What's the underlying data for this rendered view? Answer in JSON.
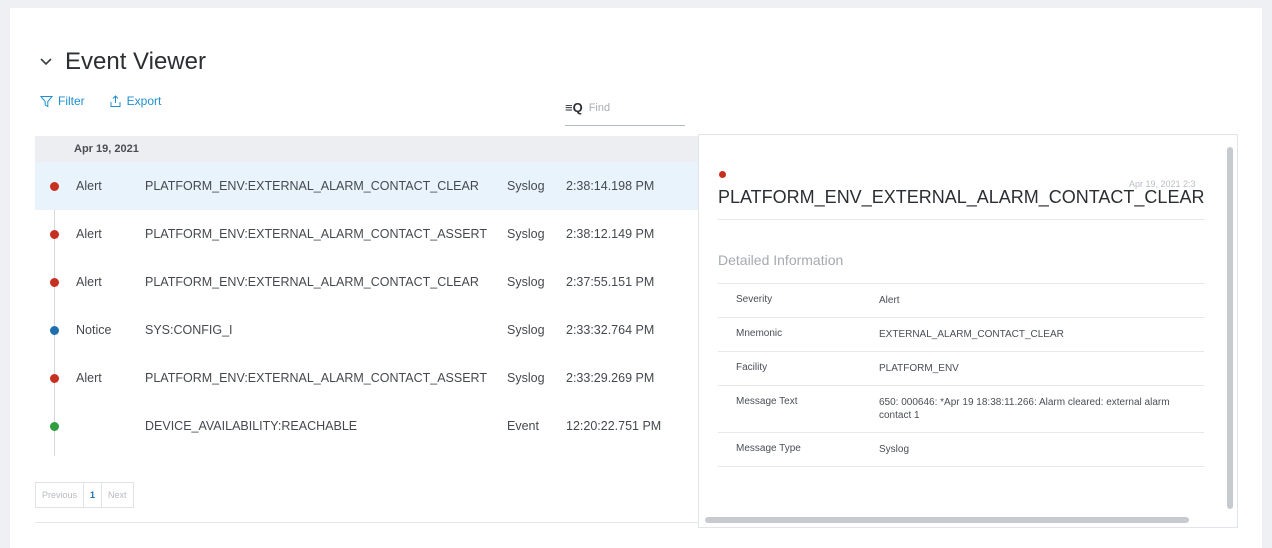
{
  "header": {
    "title": "Event Viewer"
  },
  "toolbar": {
    "filter_label": "Filter",
    "export_label": "Export"
  },
  "search": {
    "icon_label": "≡Q",
    "placeholder": "Find"
  },
  "list": {
    "date": "Apr 19, 2021",
    "events": [
      {
        "severity": "Alert",
        "mnemonic": "PLATFORM_ENV:EXTERNAL_ALARM_CONTACT_CLEAR",
        "source": "Syslog",
        "time": "2:38:14.198 PM",
        "color": "#c7301e"
      },
      {
        "severity": "Alert",
        "mnemonic": "PLATFORM_ENV:EXTERNAL_ALARM_CONTACT_ASSERT",
        "source": "Syslog",
        "time": "2:38:12.149 PM",
        "color": "#c7301e"
      },
      {
        "severity": "Alert",
        "mnemonic": "PLATFORM_ENV:EXTERNAL_ALARM_CONTACT_CLEAR",
        "source": "Syslog",
        "time": "2:37:55.151 PM",
        "color": "#c7301e"
      },
      {
        "severity": "Notice",
        "mnemonic": "SYS:CONFIG_I",
        "source": "Syslog",
        "time": "2:33:32.764 PM",
        "color": "#1f6fb0"
      },
      {
        "severity": "Alert",
        "mnemonic": "PLATFORM_ENV:EXTERNAL_ALARM_CONTACT_ASSERT",
        "source": "Syslog",
        "time": "2:33:29.269 PM",
        "color": "#c7301e"
      },
      {
        "severity": "",
        "mnemonic": "DEVICE_AVAILABILITY:REACHABLE",
        "source": "Event",
        "time": "12:20:22.751 PM",
        "color": "#2e9e3f"
      }
    ]
  },
  "pagination": {
    "previous": "Previous",
    "page": "1",
    "next": "Next"
  },
  "detail": {
    "title": "PLATFORM_ENV_EXTERNAL_ALARM_CONTACT_CLEAR",
    "timestamp": "Apr 19, 2021 2:3",
    "section_title": "Detailed Information",
    "rows": [
      {
        "key": "Severity",
        "value": "Alert"
      },
      {
        "key": "Mnemonic",
        "value": "EXTERNAL_ALARM_CONTACT_CLEAR"
      },
      {
        "key": "Facility",
        "value": "PLATFORM_ENV"
      },
      {
        "key": "Message Text",
        "value": "650: 000646: *Apr 19 18:38:11.266: Alarm cleared: external alarm contact 1"
      },
      {
        "key": "Message Type",
        "value": "Syslog"
      }
    ]
  }
}
